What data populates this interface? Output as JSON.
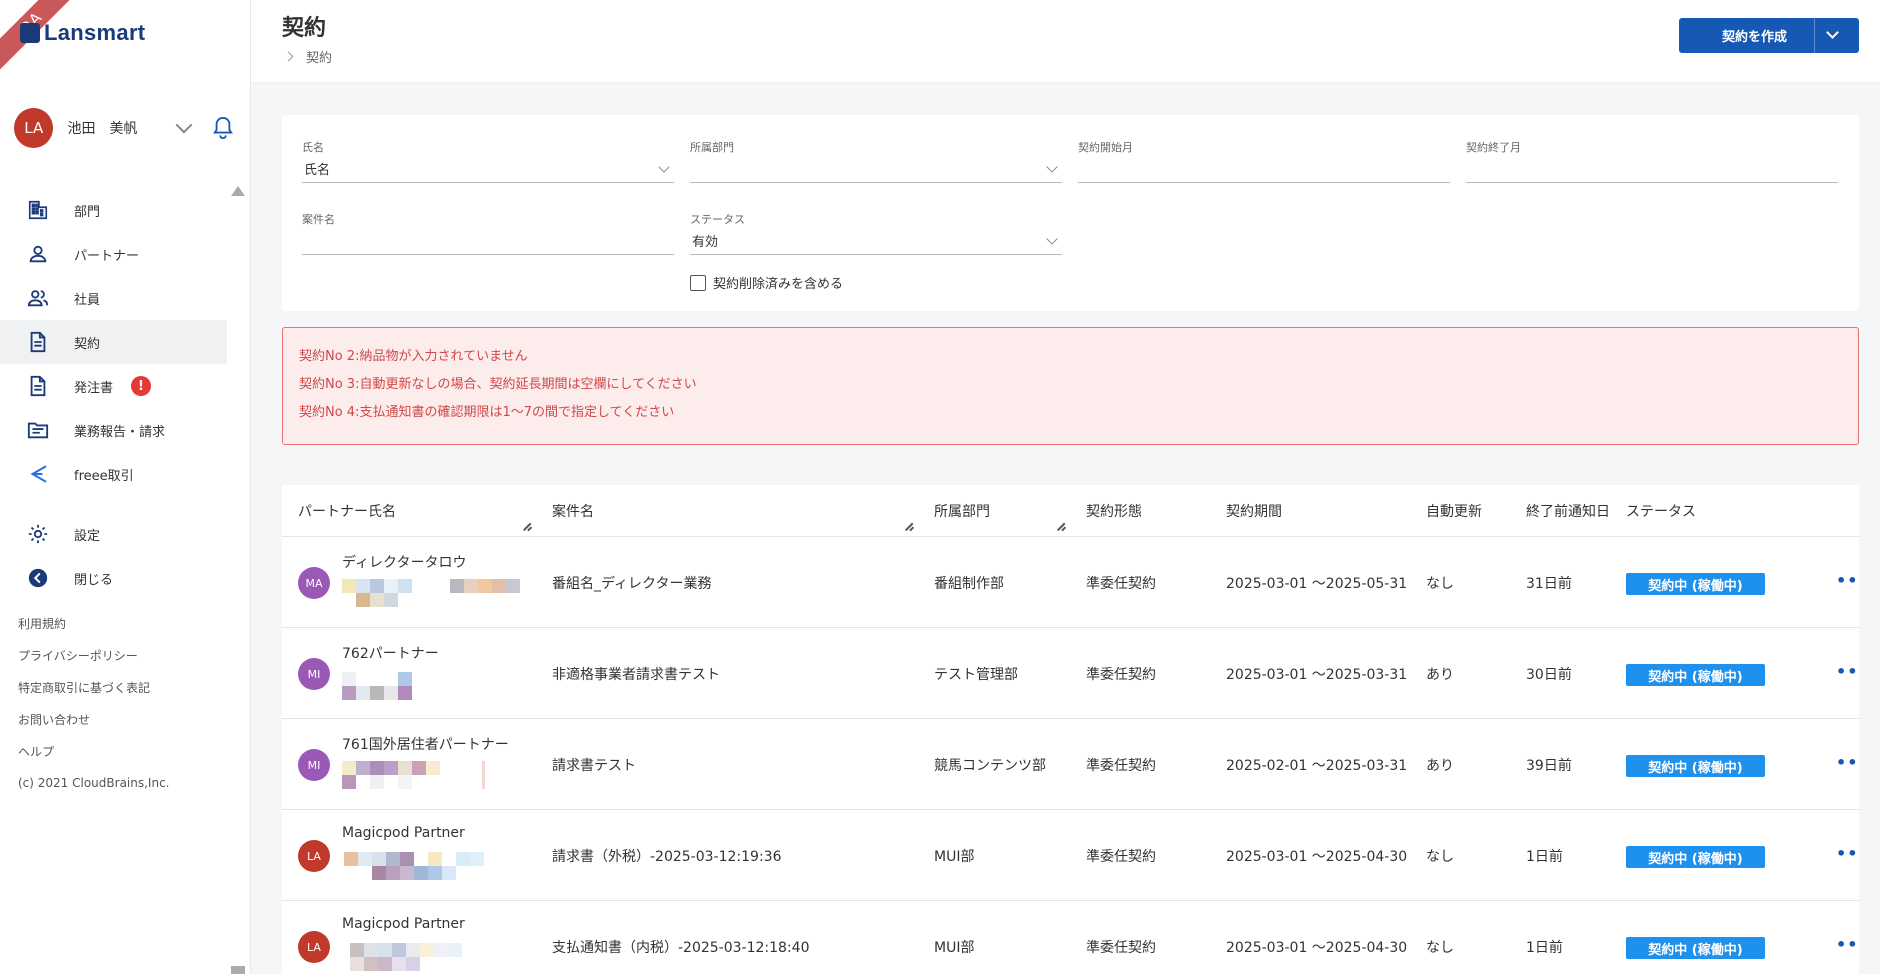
{
  "env_ribbon": "QA",
  "brand": {
    "name": "Lansmart"
  },
  "user": {
    "initials": "LA",
    "name": "池田　美帆"
  },
  "nav": {
    "items": [
      {
        "label": "部門",
        "icon": "building-icon"
      },
      {
        "label": "パートナー",
        "icon": "person-icon"
      },
      {
        "label": "社員",
        "icon": "people-icon"
      },
      {
        "label": "契約",
        "icon": "document-icon"
      },
      {
        "label": "発注書",
        "icon": "document-icon",
        "badge": "!"
      },
      {
        "label": "業務報告・請求",
        "icon": "folder-icon"
      },
      {
        "label": "freee取引",
        "icon": "freee-icon"
      },
      {
        "label": "設定",
        "icon": "gear-icon"
      },
      {
        "label": "閉じる",
        "icon": "arrow-left-circle-icon"
      }
    ]
  },
  "footer": {
    "links": [
      "利用規約",
      "プライバシーポリシー",
      "特定商取引に基づく表記",
      "お問い合わせ",
      "ヘルプ"
    ],
    "copyright": "(c) 2021 CloudBrains,Inc."
  },
  "header": {
    "title": "契約",
    "breadcrumb": "契約",
    "create_button": "契約を作成"
  },
  "filters": {
    "name": {
      "label": "氏名",
      "value": "氏名"
    },
    "department": {
      "label": "所属部門",
      "value": ""
    },
    "start_month": {
      "label": "契約開始月",
      "value": ""
    },
    "end_month": {
      "label": "契約終了月",
      "value": ""
    },
    "project": {
      "label": "案件名",
      "value": ""
    },
    "status": {
      "label": "ステータス",
      "value": "有効"
    },
    "include_deleted": "契約削除済みを含める"
  },
  "errors": [
    "契約No 2:納品物が入力されていません",
    "契約No 3:自動更新なしの場合、契約延長期間は空欄にしてください",
    "契約No 4:支払通知書の確認期限は1〜7の間で指定してください"
  ],
  "table": {
    "headers": {
      "partner": "パートナー氏名",
      "project": "案件名",
      "department": "所属部門",
      "contract_type": "契約形態",
      "period": "契約期間",
      "auto_renew": "自動更新",
      "notice": "終了前通知日",
      "status": "ステータス"
    },
    "rows": [
      {
        "initials": "MA",
        "avatar_color": "#9b59b6",
        "partner": "ディレクタータロウ",
        "project": "番組名_ディレクター業務",
        "department": "番組制作部",
        "contract_type": "準委任契約",
        "period": "2025-03-01 〜2025-05-31",
        "auto_renew": "なし",
        "notice": "31日前",
        "status": "契約中 (稼働中)"
      },
      {
        "initials": "MI",
        "avatar_color": "#9b59b6",
        "partner": "762パートナー",
        "project": "非適格事業者請求書テスト",
        "department": "テスト管理部",
        "contract_type": "準委任契約",
        "period": "2025-03-01 〜2025-03-31",
        "auto_renew": "あり",
        "notice": "30日前",
        "status": "契約中 (稼働中)"
      },
      {
        "initials": "MI",
        "avatar_color": "#9b59b6",
        "partner": "761国外居住者パートナー",
        "project": "請求書テスト",
        "department": "競馬コンテンツ部",
        "contract_type": "準委任契約",
        "period": "2025-02-01 〜2025-03-31",
        "auto_renew": "あり",
        "notice": "39日前",
        "status": "契約中 (稼働中)"
      },
      {
        "initials": "LA",
        "avatar_color": "#c0392b",
        "partner": "Magicpod Partner",
        "project": "請求書（外税）-2025-03-12:19:36",
        "department": "MUI部",
        "contract_type": "準委任契約",
        "period": "2025-03-01 〜2025-04-30",
        "auto_renew": "なし",
        "notice": "1日前",
        "status": "契約中 (稼働中)"
      },
      {
        "initials": "LA",
        "avatar_color": "#c0392b",
        "partner": "Magicpod Partner",
        "project": "支払通知書（内税）-2025-03-12:18:40",
        "department": "MUI部",
        "contract_type": "準委任契約",
        "period": "2025-03-01 〜2025-04-30",
        "auto_renew": "なし",
        "notice": "1日前",
        "status": "契約中 (稼働中)"
      }
    ]
  },
  "colors": {
    "primary": "#1559b5",
    "status_active": "#1e90ee",
    "error_text": "#d04848",
    "error_bg": "#fdecec",
    "badge_red": "#e53935"
  }
}
